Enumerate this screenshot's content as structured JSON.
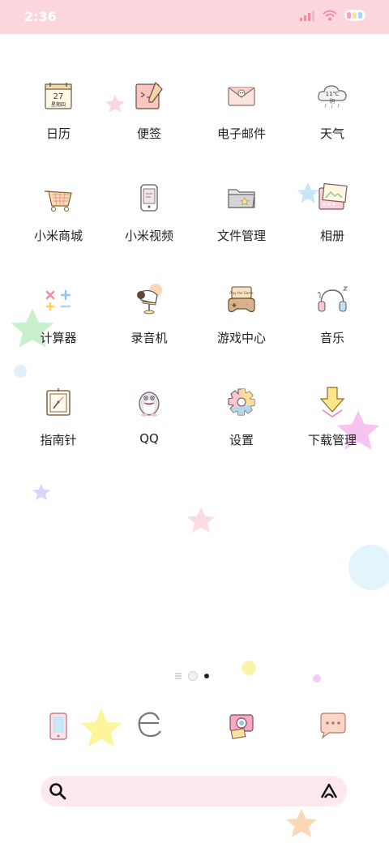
{
  "status_bar": {
    "time": "2:36"
  },
  "apps": [
    {
      "label": "日历",
      "icon": "calendar-icon",
      "day": "27",
      "weekday": "星期四"
    },
    {
      "label": "便签",
      "icon": "notes-icon"
    },
    {
      "label": "电子邮件",
      "icon": "email-icon"
    },
    {
      "label": "天气",
      "icon": "weather-icon",
      "temp": "11℃",
      "cond": "阴"
    },
    {
      "label": "小米商城",
      "icon": "shopping-cart-icon"
    },
    {
      "label": "小米视频",
      "icon": "video-icon"
    },
    {
      "label": "文件管理",
      "icon": "folder-icon"
    },
    {
      "label": "相册",
      "icon": "gallery-icon"
    },
    {
      "label": "计算器",
      "icon": "calculator-icon"
    },
    {
      "label": "录音机",
      "icon": "recorder-icon"
    },
    {
      "label": "游戏中心",
      "icon": "game-controller-icon",
      "screen": "Play the Game"
    },
    {
      "label": "音乐",
      "icon": "headphones-icon"
    },
    {
      "label": "指南针",
      "icon": "compass-icon"
    },
    {
      "label": "QQ",
      "icon": "qq-penguin-icon"
    },
    {
      "label": "设置",
      "icon": "gear-icon"
    },
    {
      "label": "下载管理",
      "icon": "download-icon"
    }
  ],
  "dock": [
    {
      "icon": "phone-icon"
    },
    {
      "icon": "browser-icon"
    },
    {
      "icon": "camera-icon"
    },
    {
      "icon": "messages-icon"
    }
  ],
  "search_bar": {
    "left_icon": "search-icon",
    "right_icon": "xiaoai-icon"
  },
  "colors": {
    "status_bg": "#fbd6dc",
    "search_bg": "#fde9ed",
    "accent_pink": "#f6a7b7"
  }
}
